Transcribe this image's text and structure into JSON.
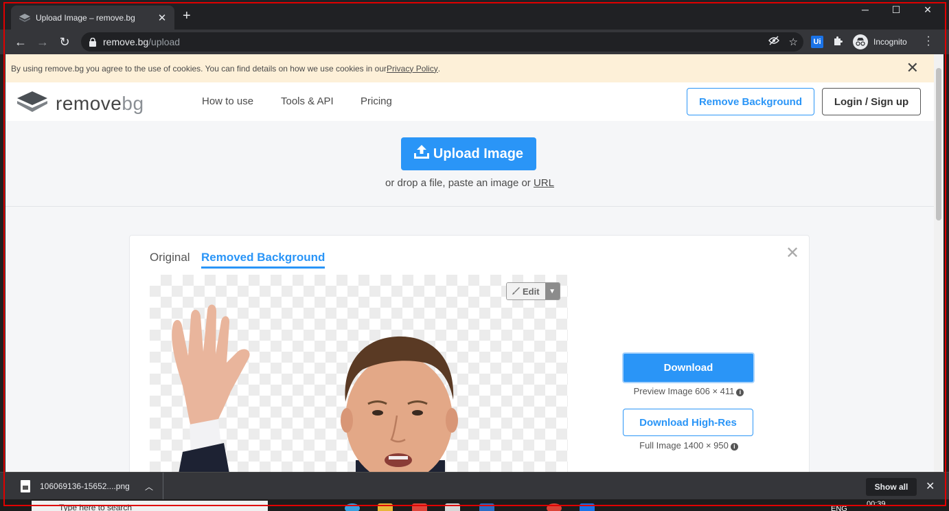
{
  "browser": {
    "tab_title": "Upload Image – remove.bg",
    "new_tab_symbol": "+",
    "url_host": "remove.bg",
    "url_path": "/upload",
    "profile_label": "Incognito",
    "extension_label": "Ui"
  },
  "cookie_banner": {
    "text": "By using remove.bg you agree to the use of cookies. You can find details on how we use cookies in our ",
    "link": "Privacy Policy",
    "suffix": "."
  },
  "header": {
    "logo_text_main": "remove",
    "logo_text_bg": "bg",
    "nav": [
      "How to use",
      "Tools & API",
      "Pricing"
    ],
    "remove_background_button": "Remove Background",
    "login_button": "Login / Sign up"
  },
  "upload": {
    "button_label": "Upload Image",
    "hint_text": "or drop a file, paste an image or ",
    "hint_link": "URL"
  },
  "result": {
    "tab_original": "Original",
    "tab_removed": "Removed Background",
    "edit_label": "Edit",
    "download_label": "Download",
    "preview_info": "Preview Image 606 × 411",
    "download_hires_label": "Download High-Res",
    "full_info": "Full Image 1400 × 950"
  },
  "download_shelf": {
    "file_name": "106069136-15652....png",
    "show_all": "Show all"
  },
  "taskbar": {
    "search_placeholder": "Type here to search",
    "language": "ENG",
    "time": "00:39"
  },
  "colors": {
    "accent": "#2a95f7",
    "cookie_bg": "#fdf0d8",
    "chrome_dark": "#202124",
    "chrome_toolbar": "#35363a",
    "outline": "#e00000"
  }
}
